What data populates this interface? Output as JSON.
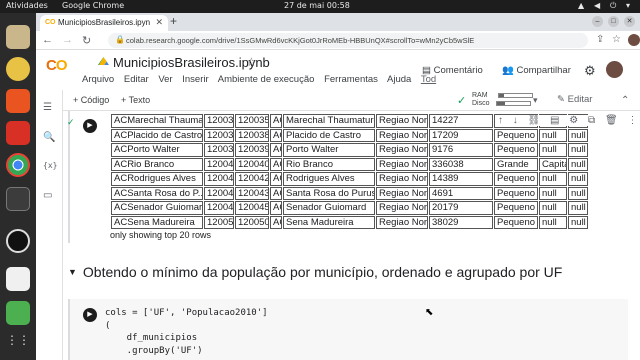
{
  "os": {
    "activities": "Atividades",
    "app": "Google Chrome",
    "clock": "27 de mai  00:58"
  },
  "browser": {
    "tab_title": "MunicipiosBrasileiros.ipyn",
    "url": "colab.research.google.com/drive/1SsGMwRd6vcKKjGot0JrRoMEb-HBBUnQX#scrollTo=wMn2yCb5wSlE"
  },
  "colab": {
    "notebook_name": "MunicipiosBrasileiros.ipynb",
    "menus": [
      "Arquivo",
      "Editar",
      "Ver",
      "Inserir",
      "Ambiente de execução",
      "Ferramentas",
      "Ajuda"
    ],
    "menu_last": "Tod",
    "comment_label": "Comentário",
    "share_label": "Compartilhar",
    "add_code": "+ Código",
    "add_text": "+ Texto",
    "ram_label": "RAM",
    "disk_label": "Disco",
    "ram_usage": 0.15,
    "disk_usage": 0.25,
    "edit_label": "Editar"
  },
  "output_table": {
    "rows": [
      [
        "ACMarechal Thauma...",
        "120035",
        "1200351",
        "AC",
        "Marechal Thaumaturgo",
        "Regiao Norte",
        "14227",
        "",
        "",
        ""
      ],
      [
        "ACPlacido de Castro",
        "120038",
        "1200385",
        "AC",
        "Placido de Castro",
        "Regiao Norte",
        "17209",
        "Pequeno I",
        "null",
        "null"
      ],
      [
        "ACPorto Walter",
        "120039",
        "1200393",
        "AC",
        "Porto Walter",
        "Regiao Norte",
        "9176",
        "Pequeno I",
        "null",
        "null"
      ],
      [
        "ACRio Branco",
        "120040",
        "1200401",
        "AC",
        "Rio Branco",
        "Regiao Norte",
        "336038",
        "Grande",
        "Capital",
        "null"
      ],
      [
        "ACRodrigues Alves",
        "120042",
        "1200427",
        "AC",
        "Rodrigues Alves",
        "Regiao Norte",
        "14389",
        "Pequeno I",
        "null",
        "null"
      ],
      [
        "ACSanta Rosa do P...",
        "120043",
        "1200435",
        "AC",
        "Santa Rosa do Purus",
        "Regiao Norte",
        "4691",
        "Pequeno I",
        "null",
        "null"
      ],
      [
        "ACSenador Guiomard",
        "120045",
        "1200450",
        "AC",
        "Senador Guiomard",
        "Regiao Norte",
        "20179",
        "Pequeno II",
        "null",
        "null"
      ],
      [
        "ACSena Madureira",
        "120050",
        "1200500",
        "AC",
        "Sena Madureira",
        "Regiao Norte",
        "38029",
        "Pequeno II",
        "null",
        "null"
      ]
    ],
    "footer": "only showing top 20 rows"
  },
  "section_heading": "Obtendo o mínimo da população por município, ordenado e agrupado por UF",
  "code_lines": [
    "cols = ['UF', 'Populacao2010']",
    "(",
    "    df_municipios",
    "    .groupBy('UF')"
  ]
}
